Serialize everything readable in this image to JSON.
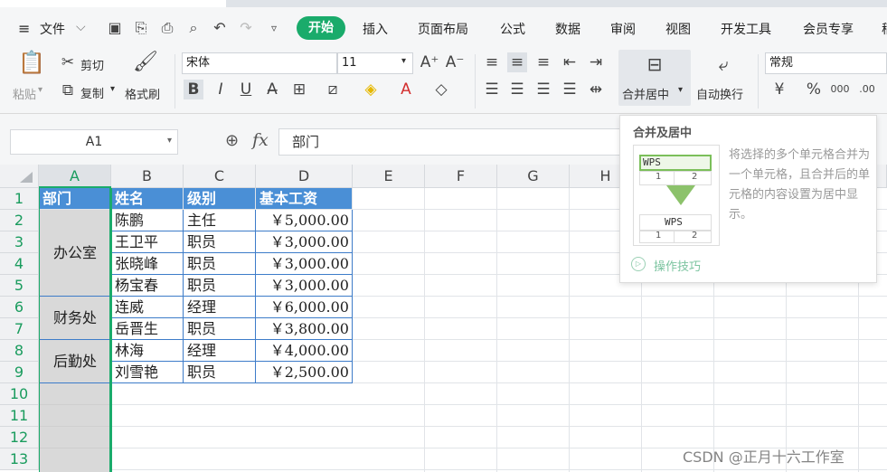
{
  "menu": {
    "file_label": "文件",
    "tabs": [
      "开始",
      "插入",
      "页面布局",
      "公式",
      "数据",
      "审阅",
      "视图",
      "开发工具",
      "会员专享",
      "稻"
    ]
  },
  "ribbon": {
    "paste": "粘贴",
    "cut": "剪切",
    "copy": "复制",
    "format_painter": "格式刷",
    "font_name": "宋体",
    "font_size": "11",
    "merge_center": "合并居中",
    "wrap_text": "自动换行",
    "number_format": "常规",
    "currency_symbol": "¥",
    "percent_symbol": "%"
  },
  "formula_bar": {
    "name_box": "A1",
    "fx": "fx",
    "value": "部门"
  },
  "columns": [
    "A",
    "B",
    "C",
    "D",
    "E",
    "F",
    "G",
    "H"
  ],
  "rows": [
    "1",
    "2",
    "3",
    "4",
    "5",
    "6",
    "7",
    "8",
    "9",
    "10",
    "11",
    "12",
    "13"
  ],
  "table": {
    "headers": [
      "部门",
      "姓名",
      "级别",
      "基本工资"
    ],
    "departments": [
      "办公室",
      "财务处",
      "后勤处"
    ],
    "records": [
      [
        "陈鹏",
        "主任",
        "￥5,000.00"
      ],
      [
        "王卫平",
        "职员",
        "￥3,000.00"
      ],
      [
        "张晓峰",
        "职员",
        "￥3,000.00"
      ],
      [
        "杨宝春",
        "职员",
        "￥3,000.00"
      ],
      [
        "连威",
        "经理",
        "￥6,000.00"
      ],
      [
        "岳晋生",
        "职员",
        "￥3,800.00"
      ],
      [
        "林海",
        "经理",
        "￥4,000.00"
      ],
      [
        "刘雪艳",
        "职员",
        "￥2,500.00"
      ]
    ]
  },
  "popup": {
    "title": "合并及居中",
    "description": "将选择的多个单元格合并为一个单元格，且合并后的单元格的内容设置为居中显示。",
    "demo_top": "WPS",
    "demo_n1": "1",
    "demo_n2": "2",
    "demo_bottom": "WPS",
    "link": "操作技巧"
  },
  "watermark": "CSDN @正月十六工作室",
  "colors": {
    "accent_green": "#1aab6b",
    "header_blue": "#4a8fd6",
    "merged_gray": "#d9d9d9"
  }
}
